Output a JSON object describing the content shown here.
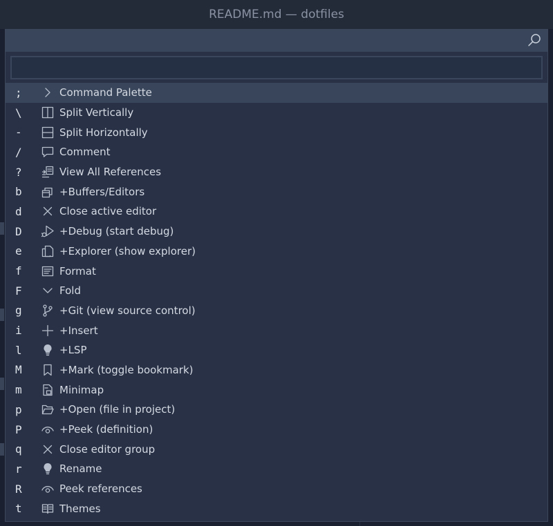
{
  "window": {
    "title": "README.md — dotfiles"
  },
  "quick_pick": {
    "input_value": "",
    "items": [
      {
        "key": ";",
        "icon": "chevron-right-icon",
        "label": "Command Palette"
      },
      {
        "key": "\\",
        "icon": "split-vertical-icon",
        "label": "Split Vertically"
      },
      {
        "key": "-",
        "icon": "split-horizontal-icon",
        "label": "Split Horizontally"
      },
      {
        "key": "/",
        "icon": "comment-icon",
        "label": "Comment"
      },
      {
        "key": "?",
        "icon": "references-icon",
        "label": "View All References"
      },
      {
        "key": "b",
        "icon": "buffers-icon",
        "label": "+Buffers/Editors"
      },
      {
        "key": "d",
        "icon": "close-icon",
        "label": "Close active editor"
      },
      {
        "key": "D",
        "icon": "debug-icon",
        "label": "+Debug (start debug)"
      },
      {
        "key": "e",
        "icon": "files-icon",
        "label": "+Explorer (show explorer)"
      },
      {
        "key": "f",
        "icon": "format-icon",
        "label": "Format"
      },
      {
        "key": "F",
        "icon": "chevron-down-icon",
        "label": "Fold"
      },
      {
        "key": "g",
        "icon": "git-branch-icon",
        "label": "+Git (view source control)"
      },
      {
        "key": "i",
        "icon": "plus-icon",
        "label": "+Insert"
      },
      {
        "key": "l",
        "icon": "lightbulb-icon",
        "label": "+LSP"
      },
      {
        "key": "M",
        "icon": "bookmark-icon",
        "label": "+Mark (toggle bookmark)"
      },
      {
        "key": "m",
        "icon": "minimap-icon",
        "label": "Minimap"
      },
      {
        "key": "p",
        "icon": "folder-open-icon",
        "label": "+Open (file in project)"
      },
      {
        "key": "P",
        "icon": "eye-icon",
        "label": "+Peek (definition)"
      },
      {
        "key": "q",
        "icon": "close-icon",
        "label": "Close editor group"
      },
      {
        "key": "r",
        "icon": "lightbulb-icon",
        "label": "Rename"
      },
      {
        "key": "R",
        "icon": "eye-icon",
        "label": "Peek references"
      },
      {
        "key": "t",
        "icon": "book-icon",
        "label": "Themes"
      }
    ]
  },
  "colors": {
    "background": "#1d2333",
    "panel": "#283146",
    "selected_row": "#38455a",
    "text": "#d5dae3",
    "icon": "#b7bfcc"
  }
}
